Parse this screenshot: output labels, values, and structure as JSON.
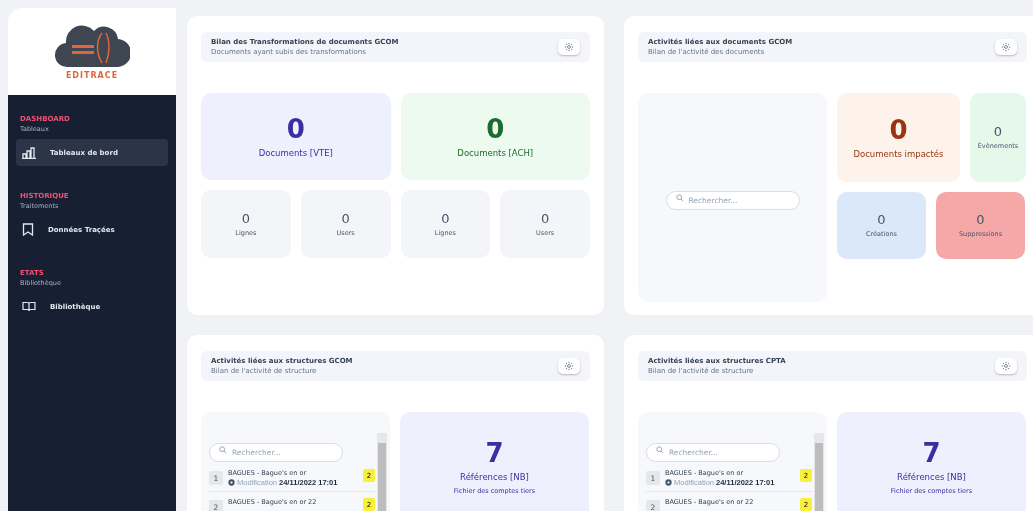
{
  "sidebar": {
    "logo_text": "EDITRACE",
    "sections": [
      {
        "title": "DASHBOARD",
        "subtitle": "Tableaux",
        "items": [
          {
            "label": "Tableaux de bord",
            "selected": true
          }
        ]
      },
      {
        "title": "HISTORIQUE",
        "subtitle": "Traitements",
        "items": [
          {
            "label": "Données Traçées",
            "selected": false
          }
        ]
      },
      {
        "title": "ETATS",
        "subtitle": "Bibliothèque",
        "items": [
          {
            "label": "Bibliothèque",
            "selected": false
          }
        ]
      }
    ]
  },
  "cards": [
    {
      "kind": "transformations",
      "title": "Bilan des Transformations de documents GCOM",
      "subtitle": "Documents ayant subis des transformations",
      "big": [
        {
          "value": "0",
          "label": "Documents [VTE]",
          "color": "#eef0fd"
        },
        {
          "value": "0",
          "label": "Documents [ACH]",
          "color": "#edfaef"
        }
      ],
      "small": [
        {
          "value": "0",
          "label": "Lignes",
          "color": "#f3f5f9"
        },
        {
          "value": "0",
          "label": "Users",
          "color": "#f3f5f9"
        },
        {
          "value": "0",
          "label": "Lignes",
          "color": "#f3f5f9"
        },
        {
          "value": "0",
          "label": "Users",
          "color": "#f3f5f9"
        }
      ]
    },
    {
      "kind": "activity",
      "title": "Activités liées aux documents GCOM",
      "subtitle": "Bilan de l'activité des documents",
      "search": {
        "placeholder": "Rechercher..."
      },
      "tiles": [
        {
          "value": "0",
          "label": "Documents impactés",
          "color": "#fdf3ea"
        },
        {
          "value": "0",
          "label": "Évènements",
          "color": "#e5f8ea"
        },
        {
          "value": "0",
          "label": "Créations",
          "color": "#dbe8fa"
        },
        {
          "value": "0",
          "label": "Suppressions",
          "color": "#f6a8a8"
        }
      ]
    },
    {
      "kind": "structures",
      "title": "Activités liées aux structures GCOM",
      "subtitle": "Bilan de l'activité de structure",
      "search": {
        "placeholder": "Rechercher..."
      },
      "rows": [
        {
          "number": "1",
          "title": "BAGUES - Bague's en or",
          "action": "Modification",
          "date": "24/11/2022 17:01",
          "badge": "2"
        },
        {
          "number": "2",
          "title": "BAGUES - Bague's en or 22",
          "badge": "2"
        }
      ],
      "tile": {
        "value": "7",
        "label": "Références [NB]",
        "caption": "Fichier des comptes tiers",
        "color": "#eef0fd"
      }
    },
    {
      "kind": "structures",
      "title": "Activités liées aux structures CPTA",
      "subtitle": "Bilan de l'activité de structure",
      "search": {
        "placeholder": "Rechercher..."
      },
      "rows": [
        {
          "number": "1",
          "title": "BAGUES - Bague's en or",
          "action": "Modification",
          "date": "24/11/2022 17:01",
          "badge": "2"
        },
        {
          "number": "2",
          "title": "BAGUES - Bague's en or 22",
          "badge": "2"
        }
      ],
      "tile": {
        "value": "7",
        "label": "Références [NB]",
        "caption": "Fichier des comptes tiers",
        "color": "#eef0fd"
      }
    }
  ]
}
